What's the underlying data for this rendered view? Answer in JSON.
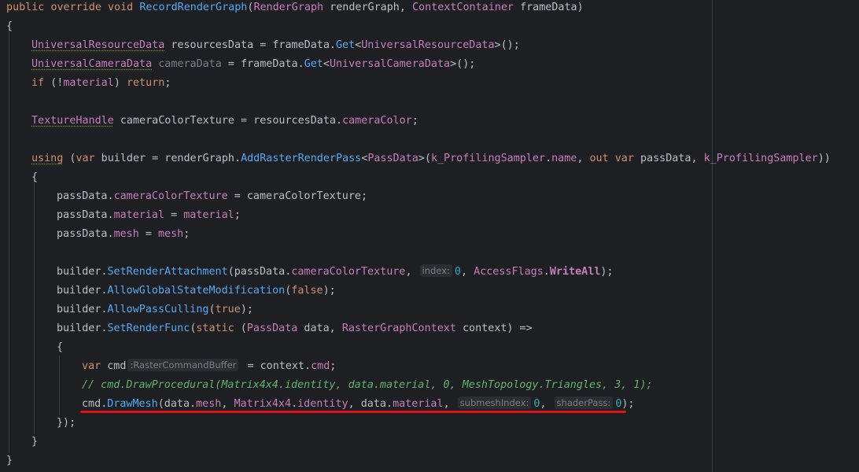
{
  "code": {
    "l1": {
      "a": "public",
      "b": "override",
      "c": "void",
      "d": "RecordRenderGraph",
      "e": "(",
      "f": "RenderGraph",
      "g": " renderGraph, ",
      "h": "ContextContainer",
      "i": " frameData)"
    },
    "l2": {
      "a": "{"
    },
    "l3": {
      "a": "UniversalResourceData",
      "b": " resourcesData = frameData.",
      "c": "Get",
      "d": "<",
      "e": "UniversalResourceData",
      "f": ">();"
    },
    "l4": {
      "a": "UniversalCameraData",
      "b": " ",
      "c": "cameraData",
      "d": " = frameData.",
      "e": "Get",
      "f": "<",
      "g": "UniversalCameraData",
      "h": ">();"
    },
    "l5": {
      "a": "if",
      "b": " (!",
      "c": "material",
      "d": ") ",
      "e": "return",
      "f": ";"
    },
    "l7": {
      "a": "TextureHandle",
      "b": " cameraColorTexture = resourcesData.",
      "c": "cameraColor",
      "d": ";"
    },
    "l9": {
      "a": "using",
      "b": " (",
      "c": "var",
      "d": " builder = renderGraph.",
      "e": "AddRasterRenderPass",
      "f": "<",
      "g": "PassData",
      "h": ">(",
      "i": "k_ProfilingSampler",
      "j": ".",
      "k": "name",
      "l": ", ",
      "m": "out",
      "n": " ",
      "o": "var",
      "p": " passData, ",
      "q": "k_ProfilingSampler",
      "r": "))"
    },
    "l10": {
      "a": "{"
    },
    "l11": {
      "a": "passData.",
      "b": "cameraColorTexture",
      "c": " = cameraColorTexture;"
    },
    "l12": {
      "a": "passData.",
      "b": "material",
      "c": " = ",
      "d": "material",
      "e": ";"
    },
    "l13": {
      "a": "passData.",
      "b": "mesh",
      "c": " = ",
      "d": "mesh",
      "e": ";"
    },
    "l15": {
      "a": "builder.",
      "b": "SetRenderAttachment",
      "c": "(passData.",
      "d": "cameraColorTexture",
      "e": ", ",
      "hint": "index:",
      "f": "0",
      "g": ", ",
      "h": "AccessFlags",
      "i": ".",
      "j": "WriteAll",
      "k": ");"
    },
    "l16": {
      "a": "builder.",
      "b": "AllowGlobalStateModification",
      "c": "(",
      "d": "false",
      "e": ");"
    },
    "l17": {
      "a": "builder.",
      "b": "AllowPassCulling",
      "c": "(",
      "d": "true",
      "e": ");"
    },
    "l18": {
      "a": "builder.",
      "b": "SetRenderFunc",
      "c": "(",
      "d": "static",
      "e": " (",
      "f": "PassData",
      "g": " data, ",
      "h": "RasterGraphContext",
      "i": " context) =>"
    },
    "l19": {
      "a": "{"
    },
    "l20": {
      "a": "var",
      "b": " cmd",
      "hint": ":RasterCommandBuffer",
      "c": " = context.",
      "d": "cmd",
      "e": ";"
    },
    "l21": {
      "a": "// cmd.DrawProcedural(Matrix4x4.identity, data.material, 0, MeshTopology.Triangles, 3, 1);"
    },
    "l22": {
      "a": "cmd.",
      "b": "DrawMesh",
      "c": "(data.",
      "d": "mesh",
      "e": ", ",
      "f": "Matrix4x4",
      "g": ".",
      "h": "identity",
      "i": ", data.",
      "j": "material",
      "k": ", ",
      "hint1": "submeshIndex:",
      "l": "0",
      "m": ", ",
      "hint2": "shaderPass:",
      "n": "0",
      "o": ");"
    },
    "l23": {
      "a": "});"
    },
    "l24": {
      "a": "}"
    },
    "l25": {
      "a": "}"
    }
  },
  "colors": {
    "background": "#1e1f22",
    "keyword": "#cf8e6d",
    "type": "#c77dbb",
    "method": "#56a8f5",
    "number": "#2aacb8",
    "comment": "#5fb36b",
    "annotation_underline": "#e3101a"
  }
}
